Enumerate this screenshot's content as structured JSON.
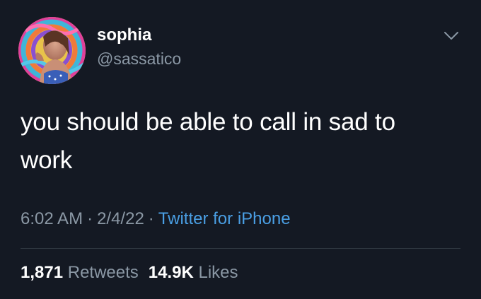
{
  "author": {
    "display_name": "sophia",
    "handle": "@sassatico"
  },
  "tweet": {
    "text": "you should be able to call in sad to work"
  },
  "meta": {
    "time": "6:02 AM",
    "separator": "·",
    "date": "2/4/22",
    "source": "Twitter for iPhone"
  },
  "stats": {
    "retweets_count": "1,871",
    "retweets_label": "Retweets",
    "likes_count": "14.9K",
    "likes_label": "Likes"
  },
  "colors": {
    "background": "#141923",
    "text": "#ffffff",
    "secondary_text": "#8b98a5",
    "link": "#4a9fe4",
    "divider": "#2f3740"
  },
  "icons": {
    "caret": "chevron-down-icon",
    "avatar": "profile-photo"
  }
}
